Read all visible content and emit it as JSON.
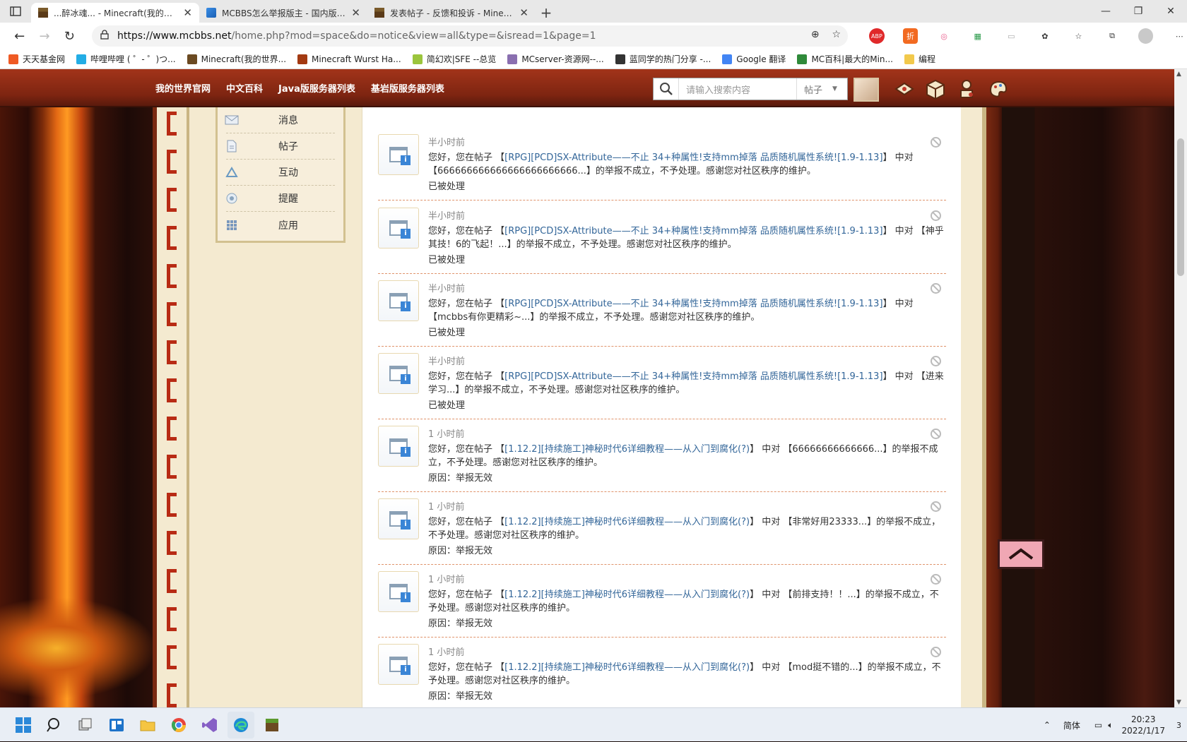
{
  "browser": {
    "tabs": [
      {
        "title": "...醉冰魂... - Minecraft(我的世界",
        "active": true
      },
      {
        "title": "MCBBS怎么举报版主 - 国内版 Bi",
        "active": false
      },
      {
        "title": "发表帖子 - 反馈和投诉 - Minecra",
        "active": false
      }
    ],
    "url_host": "https://www.mcbbs.net",
    "url_path": "/home.php?mod=space&do=notice&view=all&type=&isread=1&page=1",
    "extension_labels": {
      "abp": "ABP",
      "zhe": "折"
    },
    "bookmarks": [
      "天天基金网",
      "哔哩哔哩 ( ゜- ゜)つ...",
      "Minecraft(我的世界...",
      "Minecraft Wurst Ha...",
      "简幻欢|SFE --总览",
      "MCserver-资源网--...",
      "蓝同学的热门分享 -...",
      "Google 翻译",
      "MC百科|最大的Min...",
      "编程"
    ]
  },
  "site": {
    "nav": [
      "我的世界官网",
      "中文百科",
      "Java版服务器列表",
      "基岩版服务器列表"
    ],
    "search_placeholder": "请输入搜索内容",
    "search_type": "帖子"
  },
  "sidebar": {
    "items": [
      {
        "label": "消息",
        "icon": "envelope-icon"
      },
      {
        "label": "帖子",
        "icon": "document-icon"
      },
      {
        "label": "互动",
        "icon": "recycle-icon"
      },
      {
        "label": "提醒",
        "icon": "bell-icon"
      },
      {
        "label": "应用",
        "icon": "grid-icon"
      }
    ]
  },
  "notices": [
    {
      "time": "半小时前",
      "pre": "您好，您在帖子 【",
      "link": "[RPG][PCD]SX-Attribute——不止 34+种属性!支持mm掉落 品质随机属性系统![1.9-1.13]",
      "post": "】 中对 【666666666666666666666666...】的举报不成立，不予处理。感谢您对社区秩序的维护。",
      "status": "已被处理"
    },
    {
      "time": "半小时前",
      "pre": "您好，您在帖子 【",
      "link": "[RPG][PCD]SX-Attribute——不止 34+种属性!支持mm掉落 品质随机属性系统![1.9-1.13]",
      "post": "】 中对 【神乎其技！6的飞起！...】的举报不成立，不予处理。感谢您对社区秩序的维护。",
      "status": "已被处理"
    },
    {
      "time": "半小时前",
      "pre": "您好，您在帖子 【",
      "link": "[RPG][PCD]SX-Attribute——不止 34+种属性!支持mm掉落 品质随机属性系统![1.9-1.13]",
      "post": "】 中对 【mcbbs有你更精彩~...】的举报不成立，不予处理。感谢您对社区秩序的维护。",
      "status": "已被处理"
    },
    {
      "time": "半小时前",
      "pre": "您好，您在帖子 【",
      "link": "[RPG][PCD]SX-Attribute——不止 34+种属性!支持mm掉落 品质随机属性系统![1.9-1.13]",
      "post": "】 中对 【进来学习...】的举报不成立，不予处理。感谢您对社区秩序的维护。",
      "status": "已被处理"
    },
    {
      "time": "1 小时前",
      "pre": "您好，您在帖子 【",
      "link": "[1.12.2][持续施工]神秘时代6详细教程——从入门到腐化(?)",
      "post": "】 中对 【66666666666666...】的举报不成立，不予处理。感谢您对社区秩序的维护。",
      "status": "原因：举报无效"
    },
    {
      "time": "1 小时前",
      "pre": "您好，您在帖子 【",
      "link": "[1.12.2][持续施工]神秘时代6详细教程——从入门到腐化(?)",
      "post": "】 中对 【非常好用23333...】的举报不成立，不予处理。感谢您对社区秩序的维护。",
      "status": "原因：举报无效"
    },
    {
      "time": "1 小时前",
      "pre": "您好，您在帖子 【",
      "link": "[1.12.2][持续施工]神秘时代6详细教程——从入门到腐化(?)",
      "post": "】 中对 【前排支持！！...】的举报不成立，不予处理。感谢您对社区秩序的维护。",
      "status": "原因：举报无效"
    },
    {
      "time": "1 小时前",
      "pre": "您好，您在帖子 【",
      "link": "[1.12.2][持续施工]神秘时代6详细教程——从入门到腐化(?)",
      "post": "】 中对 【mod挺不错的...】的举报不成立，不予处理。感谢您对社区秩序的维护。",
      "status": "原因：举报无效"
    }
  ],
  "taskbar": {
    "ime": "简体",
    "time": "20:23",
    "date": "2022/1/17",
    "notification_count": "3"
  },
  "colors": {
    "nav_bg": "#8a2a14",
    "link": "#336699",
    "frame": "#f4ead0",
    "accent_red": "#b82b14"
  }
}
